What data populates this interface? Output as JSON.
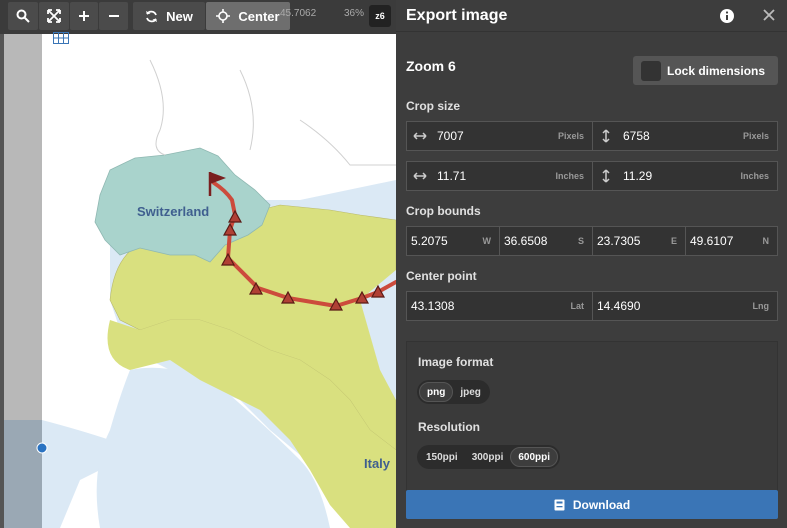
{
  "map": {
    "labels": {
      "switzerland": "Switzerland",
      "italy": "Italy"
    },
    "toolbar": {
      "new_label": "New",
      "center_label": "Center",
      "center_coord": "45.7062",
      "zoom_percent": "36%",
      "zoom_badge": "z6"
    },
    "colors": {
      "sea": "#dbe9f5",
      "italy": "#d9e07f",
      "switzerland": "#a9d3cc",
      "route": "#cc4b3c",
      "land": "#ffffff"
    }
  },
  "panel": {
    "title": "Export image",
    "zoom_title": "Zoom 6",
    "lock_label": "Lock dimensions",
    "crop_size": {
      "label": "Crop size",
      "width_px": "7007",
      "height_px": "6758",
      "px_unit": "Pixels",
      "width_in": "11.71",
      "height_in": "11.29",
      "in_unit": "Inches"
    },
    "crop_bounds": {
      "label": "Crop bounds",
      "w": "5.2075",
      "w_unit": "W",
      "s": "36.6508",
      "s_unit": "S",
      "e": "23.7305",
      "e_unit": "E",
      "n": "49.6107",
      "n_unit": "N"
    },
    "center_point": {
      "label": "Center point",
      "lat": "43.1308",
      "lat_unit": "Lat",
      "lng": "14.4690",
      "lng_unit": "Lng"
    },
    "image_format": {
      "label": "Image format",
      "options": [
        "png",
        "jpeg"
      ],
      "selected": "png"
    },
    "resolution": {
      "label": "Resolution",
      "options": [
        "150ppi",
        "300ppi",
        "600ppi"
      ],
      "selected": "600ppi"
    },
    "download_label": "Download",
    "accent_color": "#3a75b6"
  }
}
